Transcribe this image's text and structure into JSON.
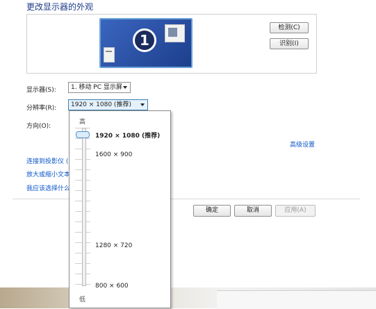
{
  "window": {
    "title": "更改显示器的外观"
  },
  "preview": {
    "monitor_number": "1"
  },
  "buttons": {
    "detect": "检测(C)",
    "identify": "识别(I)",
    "ok": "确定",
    "cancel": "取消",
    "apply": "应用(A)"
  },
  "fields": {
    "display_label": "显示器(S):",
    "display_value": "1. 移动 PC 显示屏",
    "resolution_label": "分辨率(R):",
    "resolution_value": "1920 × 1080 (推荐)",
    "orientation_label": "方向(O):"
  },
  "links": {
    "advanced": "高级设置",
    "projector": "连接到投影仪 (",
    "text_size": "放大或缩小文本",
    "which_settings": "我应该选择什么"
  },
  "resolution_dropdown": {
    "high_label": "高",
    "low_label": "低",
    "options": [
      "1920 × 1080 (推荐)",
      "1600 × 900",
      "1280 × 720",
      "800 × 600"
    ],
    "selected": "1920 × 1080 (推荐)"
  },
  "colors": {
    "link": "#0a56c8",
    "title": "#1e3b8a",
    "monitor_accent": "#2d54a8"
  }
}
